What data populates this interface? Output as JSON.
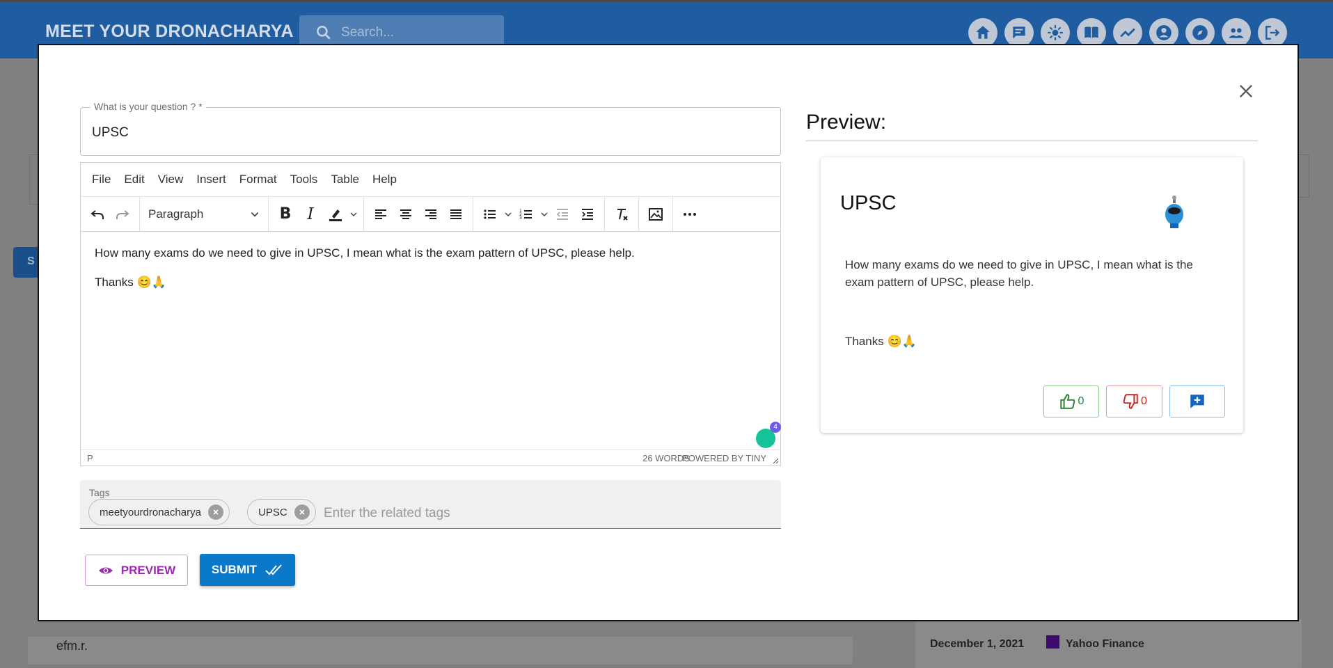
{
  "header": {
    "brand": "MEET YOUR DRONACHARYA",
    "search_placeholder": "Search...",
    "nav_icons": [
      "home-icon",
      "forum-icon",
      "brightness-icon",
      "book-icon",
      "trending-icon",
      "account-icon",
      "explore-icon",
      "group-icon",
      "logout-icon"
    ]
  },
  "background": {
    "left_button_partial": "S",
    "card_text": "efm.r.",
    "news_date": "December 1, 2021",
    "news_source": "Yahoo Finance"
  },
  "modal": {
    "question": {
      "label": "What is your question ? *",
      "value": "UPSC"
    },
    "editor": {
      "menu": [
        "File",
        "Edit",
        "View",
        "Insert",
        "Format",
        "Tools",
        "Table",
        "Help"
      ],
      "block_format": "Paragraph",
      "content": {
        "paragraph_1": "How many exams do we need to give in UPSC, I mean what is the exam pattern of UPSC, please help.",
        "paragraph_2": "Thanks 😊🙏"
      },
      "grammarly_count": "4",
      "status_path": "P",
      "word_count": "26 WORDS",
      "powered_by": "POWERED BY TINY"
    },
    "tags": {
      "label": "Tags",
      "chips": [
        "meetyourdronacharya",
        "UPSC"
      ],
      "placeholder": "Enter the related tags"
    },
    "buttons": {
      "preview": "PREVIEW",
      "submit": "SUBMIT"
    },
    "preview": {
      "heading": "Preview:",
      "card_title": "UPSC",
      "body_1": "How many exams do we need to give in UPSC, I mean what is the exam pattern of UPSC, please help.",
      "body_2": "Thanks 😊🙏",
      "upvotes": "0",
      "downvotes": "0"
    }
  },
  "colors": {
    "header_bg": "#1f5da0",
    "submit_bg": "#0b79c9",
    "preview_accent": "#9c27b0",
    "upvote": "#2e7d32",
    "downvote": "#c62828",
    "comment": "#1565c0"
  }
}
